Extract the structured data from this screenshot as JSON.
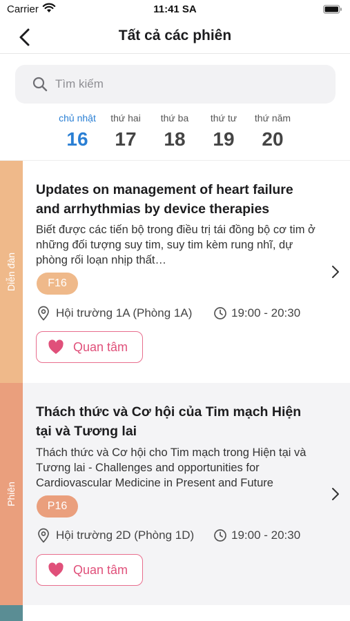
{
  "status_bar": {
    "carrier": "Carrier",
    "time": "11:41 SA"
  },
  "header": {
    "title": "Tất cả các phiên"
  },
  "search": {
    "placeholder": "Tìm kiếm"
  },
  "days": [
    {
      "name": "chủ nhật",
      "number": "16",
      "active": true
    },
    {
      "name": "thứ hai",
      "number": "17",
      "active": false
    },
    {
      "name": "thứ ba",
      "number": "18",
      "active": false
    },
    {
      "name": "thứ tư",
      "number": "19",
      "active": false
    },
    {
      "name": "thứ năm",
      "number": "20",
      "active": false
    }
  ],
  "sessions": [
    {
      "category": "Diễn đàn",
      "category_color": "#efb98a",
      "card_background": "#ffffff",
      "title": "Updates on management of heart failure and arrhythmias by device therapies",
      "description": "Biết được các tiến bộ trong điều trị tái đồng bộ cơ tim ở những đối tượng suy tim, suy tim kèm rung nhĩ, dự phòng rối loạn nhịp thất…",
      "code": "F16",
      "badge_color": "#efb98a",
      "location": "Hội trường 1A (Phòng 1A)",
      "time": "19:00 - 20:30",
      "favorite_label": "Quan tâm"
    },
    {
      "category": "Phiên",
      "category_color": "#ea9f7d",
      "card_background": "#f4f4f6",
      "title": "Thách thức và Cơ hội của Tim mạch Hiện tại và Tương lai",
      "description": "Thách thức và Cơ hội cho Tim mạch trong Hiện tại và Tương lai - Challenges and opportunities for Cardiovascular Medicine in Present and Future",
      "code": "P16",
      "badge_color": "#ea9f7d",
      "location": "Hội trường 2D (Phòng 1D)",
      "time": "19:00 - 20:30",
      "favorite_label": "Quan tâm"
    }
  ],
  "next_card_strip_color": "#5a8d94",
  "colors": {
    "accent": "#2a7fd4",
    "favorite": "#e0507a"
  }
}
